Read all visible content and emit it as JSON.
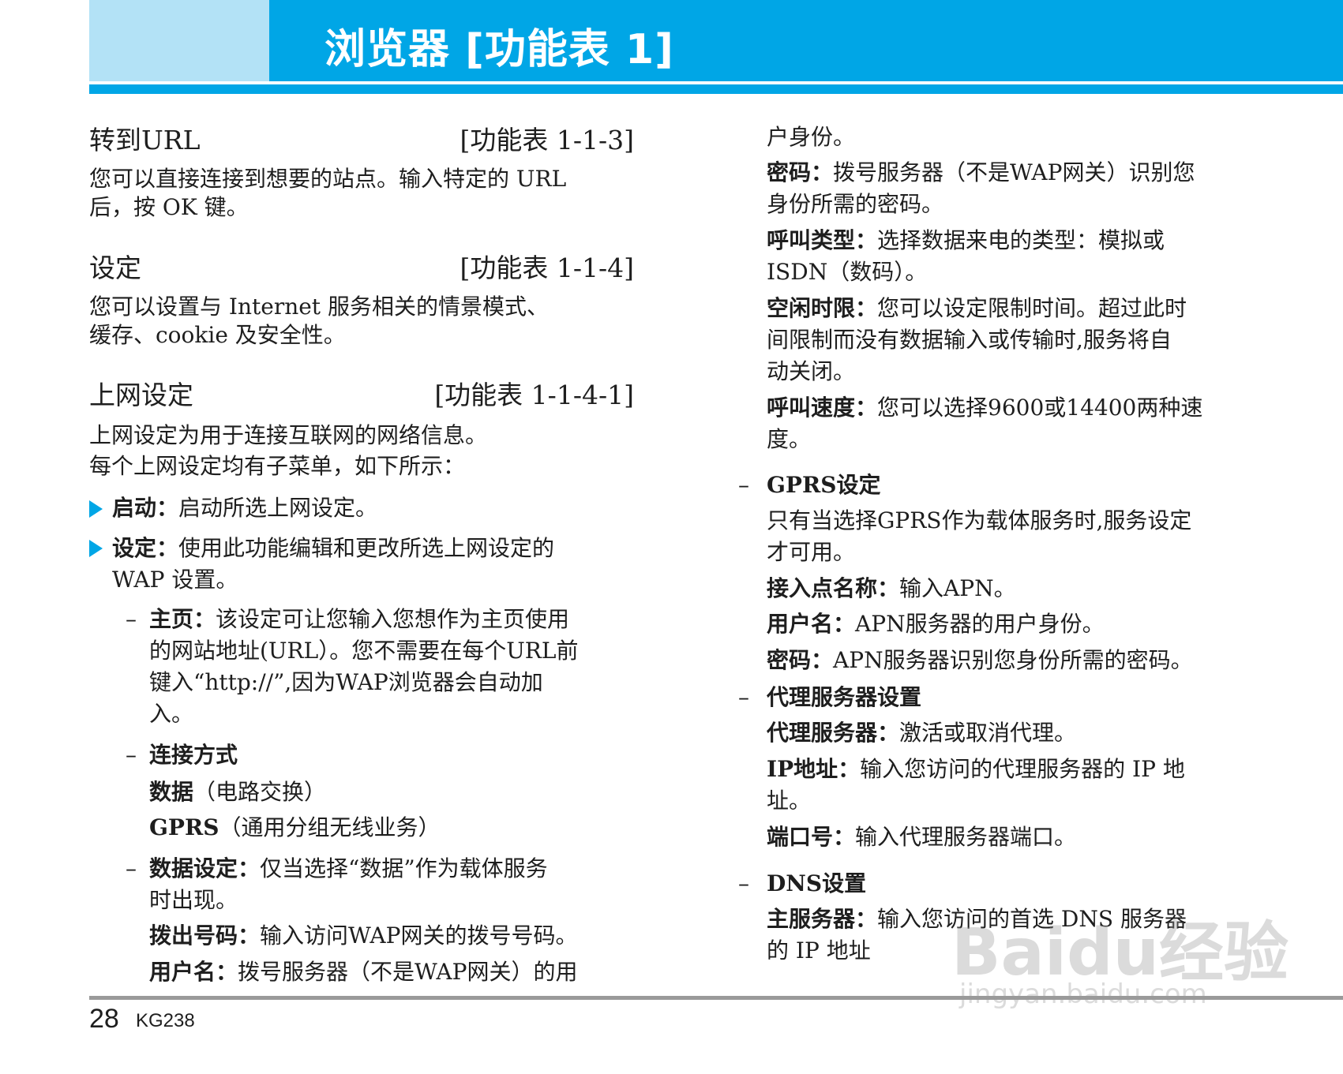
{
  "header": {
    "title": "浏览器 [功能表 1]"
  },
  "left": {
    "s1": {
      "title": "转到URL",
      "ref": "[功能表 1-1-3]",
      "l1": "您可以直接连接到想要的站点。输入特定的 URL",
      "l2": "后，按 OK 键。"
    },
    "s2": {
      "title": "设定",
      "ref": "[功能表 1-1-4]",
      "l1": "您可以设置与 Internet 服务相关的情景模式、",
      "l2": "缓存、cookie 及安全性。"
    },
    "s3": {
      "title": "上网设定",
      "ref": "[功能表 1-1-4-1]",
      "l1": "上网设定为用于连接互联网的网络信息。",
      "l2": "每个上网设定均有子菜单，如下所示："
    },
    "b1": {
      "label": "启动：",
      "text": "启动所选上网设定。"
    },
    "b2": {
      "label": "设定：",
      "text": "使用此功能编辑和更改所选上网设定的",
      "l2": "WAP 设置。"
    },
    "d1": {
      "label": "主页：",
      "text": "该设定可让您输入您想作为主页使用",
      "l2": "的网站地址(URL）。您不需要在每个URL前",
      "l3": "键入“http://”,因为WAP浏览器会自动加",
      "l4": "入。"
    },
    "d2": {
      "title": "连接方式",
      "i1_label": "数据",
      "i1_text": "（电路交换）",
      "i2_label": "GPRS",
      "i2_text": "（通用分组无线业务）"
    },
    "d3": {
      "label": "数据设定：",
      "text": "仅当选择“数据”作为载体服务",
      "l2": "时出现。",
      "dial_label": "拨出号码：",
      "dial_text": "输入访问WAP网关的拨号号码。",
      "user_label": "用户名：",
      "user_text": "拨号服务器（不是WAP网关）的用"
    }
  },
  "right": {
    "cont": "户身份。",
    "pwd": {
      "label": "密码：",
      "text": "拨号服务器（不是WAP网关）识别您",
      "l2": "身份所需的密码。"
    },
    "calltype": {
      "label": "呼叫类型：",
      "text": "选择数据来电的类型：模拟或",
      "l2": "ISDN（数码）。"
    },
    "idle": {
      "label": "空闲时限：",
      "text": "您可以设定限制时间。超过此时",
      "l2": "间限制而没有数据输入或传输时,服务将自",
      "l3": "动关闭。"
    },
    "speed": {
      "label": "呼叫速度：",
      "text": "您可以选择9600或14400两种速",
      "l2": "度。"
    },
    "gprs": {
      "title": "GPRS设定",
      "l1": "只有当选择GPRS作为载体服务时,服务设定",
      "l2": "才可用。",
      "apn_label": "接入点名称：",
      "apn_text": "输入APN。",
      "user_label": "用户名：",
      "user_text": "APN服务器的用户身份。",
      "pwd_label": "密码：",
      "pwd_text": "APN服务器识别您身份所需的密码。"
    },
    "proxy": {
      "title": "代理服务器设置",
      "p_label": "代理服务器：",
      "p_text": "激活或取消代理。",
      "ip_label": "IP地址：",
      "ip_text": "输入您访问的代理服务器的 IP 地",
      "ip_l2": "址。",
      "port_label": "端口号：",
      "port_text": "输入代理服务器端口。"
    },
    "dns": {
      "title": "DNS设置",
      "label": "主服务器：",
      "text": "输入您访问的首选 DNS 服务器",
      "l2": "的 IP 地址"
    }
  },
  "footer": {
    "page": "28",
    "model": "KG238"
  },
  "watermark": {
    "main": "Baidu经验",
    "sub": "jingyan.baidu.com"
  },
  "colors": {
    "accent": "#00a6e6",
    "accent_light": "#b3e2f6"
  }
}
